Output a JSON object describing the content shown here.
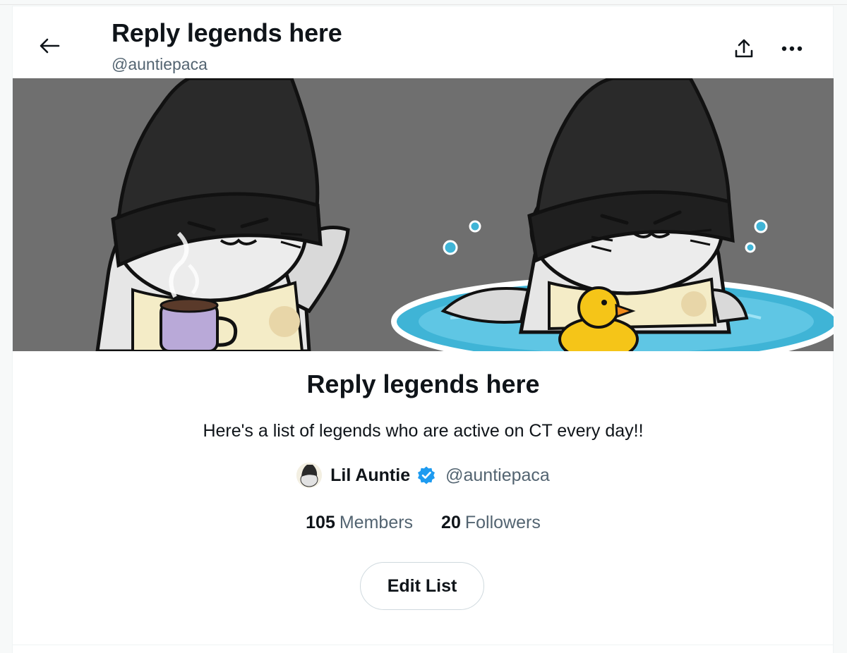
{
  "header": {
    "title": "Reply legends here",
    "handle": "@auntiepaca",
    "back_icon": "arrow-left-icon",
    "share_icon": "share-upload-icon",
    "more_icon": "more-dots-icon"
  },
  "banner": {
    "description_icon": "list-banner-image"
  },
  "list": {
    "title": "Reply legends here",
    "description": "Here's a list of legends who are active on CT every day!!",
    "owner": {
      "name": "Lil Auntie",
      "handle": "@auntiepaca",
      "verified": true
    },
    "stats": {
      "members_count": "105",
      "members_label": "Members",
      "followers_count": "20",
      "followers_label": "Followers"
    },
    "edit_button_label": "Edit List"
  },
  "colors": {
    "text_primary": "#0f1419",
    "text_secondary": "#536471",
    "verified_blue": "#1d9bf0",
    "border": "#cfd9de",
    "banner_bg": "#6f6f6f"
  }
}
